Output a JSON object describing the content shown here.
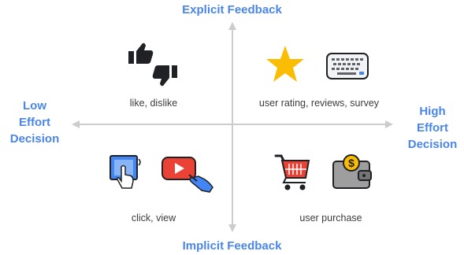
{
  "axes": {
    "top": "Explicit Feedback",
    "bottom": "Implicit Feedback",
    "left": [
      "Low",
      "Effort",
      "Decision"
    ],
    "right": [
      "High",
      "Effort",
      "Decision"
    ]
  },
  "quadrants": {
    "top_left": {
      "caption": "like, dislike",
      "icons": [
        "thumbs-up-icon",
        "thumbs-down-icon"
      ]
    },
    "top_right": {
      "caption": "user rating, reviews, survey",
      "icons": [
        "star-icon",
        "keyboard-icon"
      ]
    },
    "bottom_left": {
      "caption": "click, view",
      "icons": [
        "touch-screen-icon",
        "video-play-icon"
      ]
    },
    "bottom_right": {
      "caption": "user purchase",
      "icons": [
        "shopping-cart-icon",
        "wallet-icon"
      ]
    }
  },
  "colors": {
    "accent_text": "#4a86e8",
    "axis_line": "#cccccc",
    "star": "#fbbc04",
    "cart": "#ea4335",
    "video": "#ea4335",
    "touch": "#4285f4",
    "wallet": "#9e9e9e",
    "coin": "#fbbc04",
    "icon_dark": "#202124"
  }
}
